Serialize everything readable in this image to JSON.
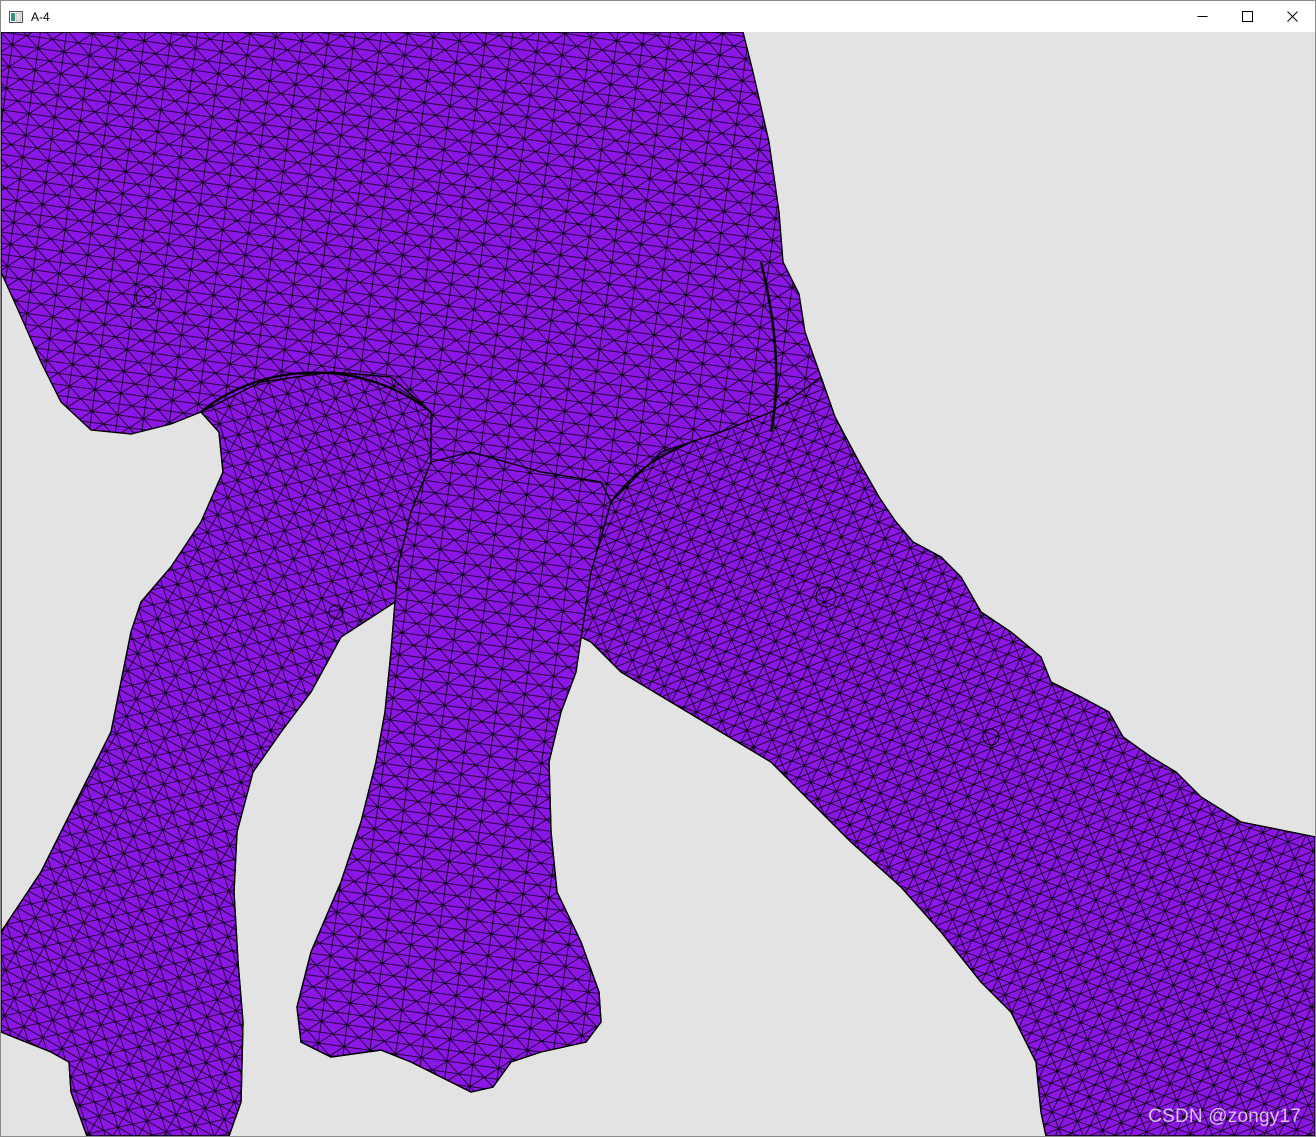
{
  "window": {
    "title": "A-4",
    "icon": "app-window-icon",
    "controls": [
      "minimize-icon",
      "maximize-icon",
      "close-icon"
    ]
  },
  "viewport": {
    "background_color": "#e3e3e3",
    "mesh_fill_color": "#8c16e6",
    "mesh_edge_color": "#000000",
    "render_mode": "wireframe-over-flat-shaded triangle mesh"
  },
  "watermark": {
    "text": "CSDN @zongy17"
  }
}
